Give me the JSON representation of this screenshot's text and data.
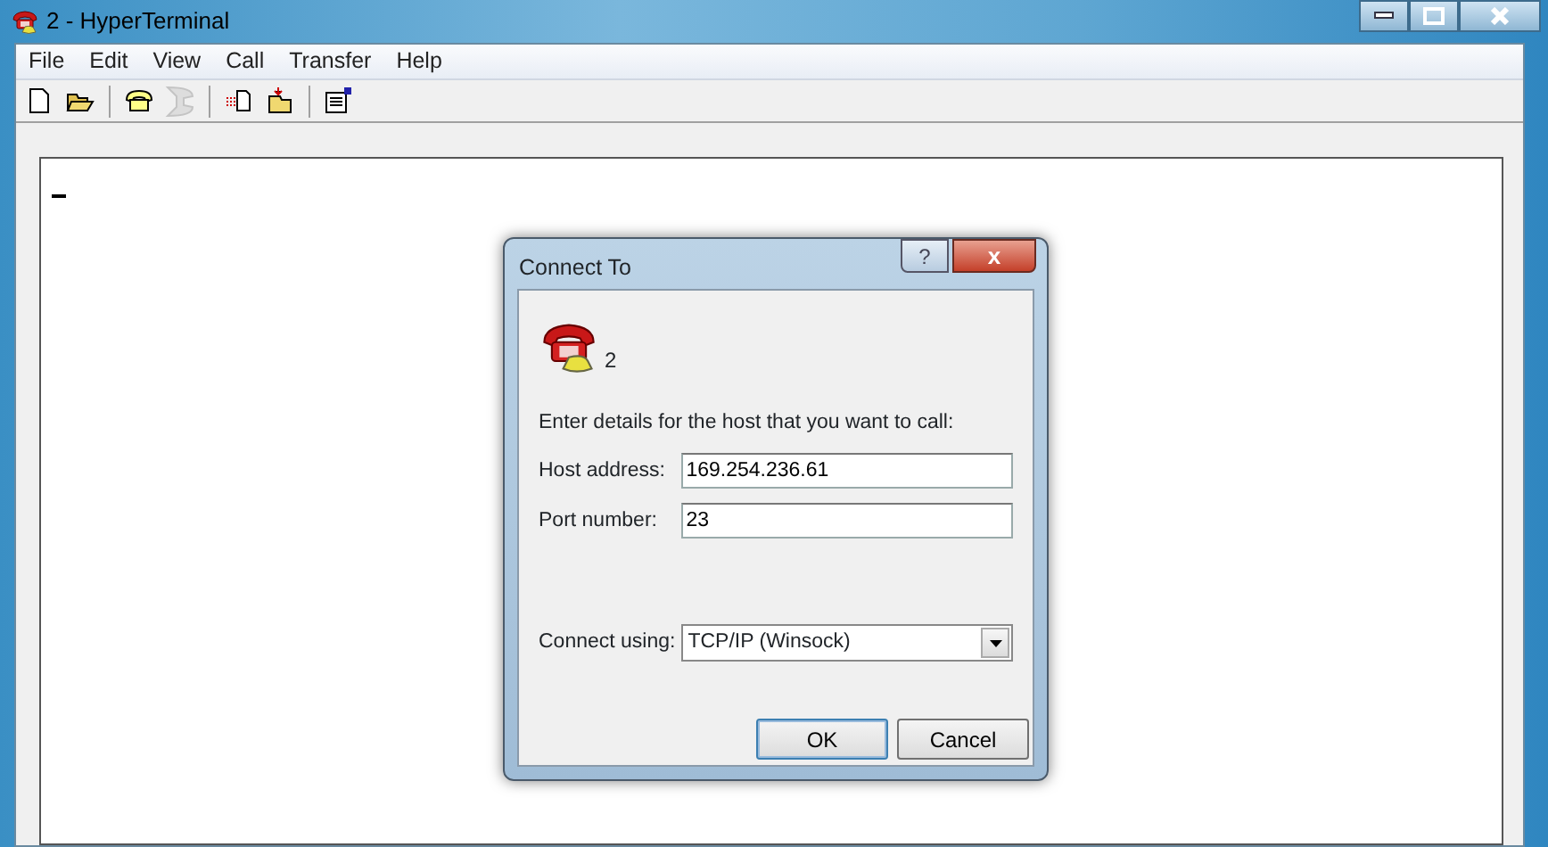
{
  "window": {
    "title": "2 - HyperTerminal"
  },
  "menu": [
    "File",
    "Edit",
    "View",
    "Call",
    "Transfer",
    "Help"
  ],
  "toolbar": [
    {
      "kind": "new",
      "disabled": false
    },
    {
      "kind": "open",
      "disabled": false
    },
    {
      "kind": "sep"
    },
    {
      "kind": "call",
      "disabled": false
    },
    {
      "kind": "disconnect",
      "disabled": true
    },
    {
      "kind": "sep"
    },
    {
      "kind": "send",
      "disabled": false
    },
    {
      "kind": "receive",
      "disabled": false
    },
    {
      "kind": "sep"
    },
    {
      "kind": "properties",
      "disabled": false
    }
  ],
  "dialog": {
    "title": "Connect To",
    "help": "?",
    "close": "x",
    "connection_name": "2",
    "prompt": "Enter details for the host that you want to call:",
    "fields": [
      {
        "kind": "text",
        "label": "Host address:",
        "value": "169.254.236.61"
      },
      {
        "kind": "text",
        "label": "Port number:",
        "value": "23"
      },
      {
        "kind": "select",
        "label": "Connect using:",
        "value": "TCP/IP (Winsock)"
      }
    ],
    "buttons": [
      "OK",
      "Cancel"
    ]
  }
}
